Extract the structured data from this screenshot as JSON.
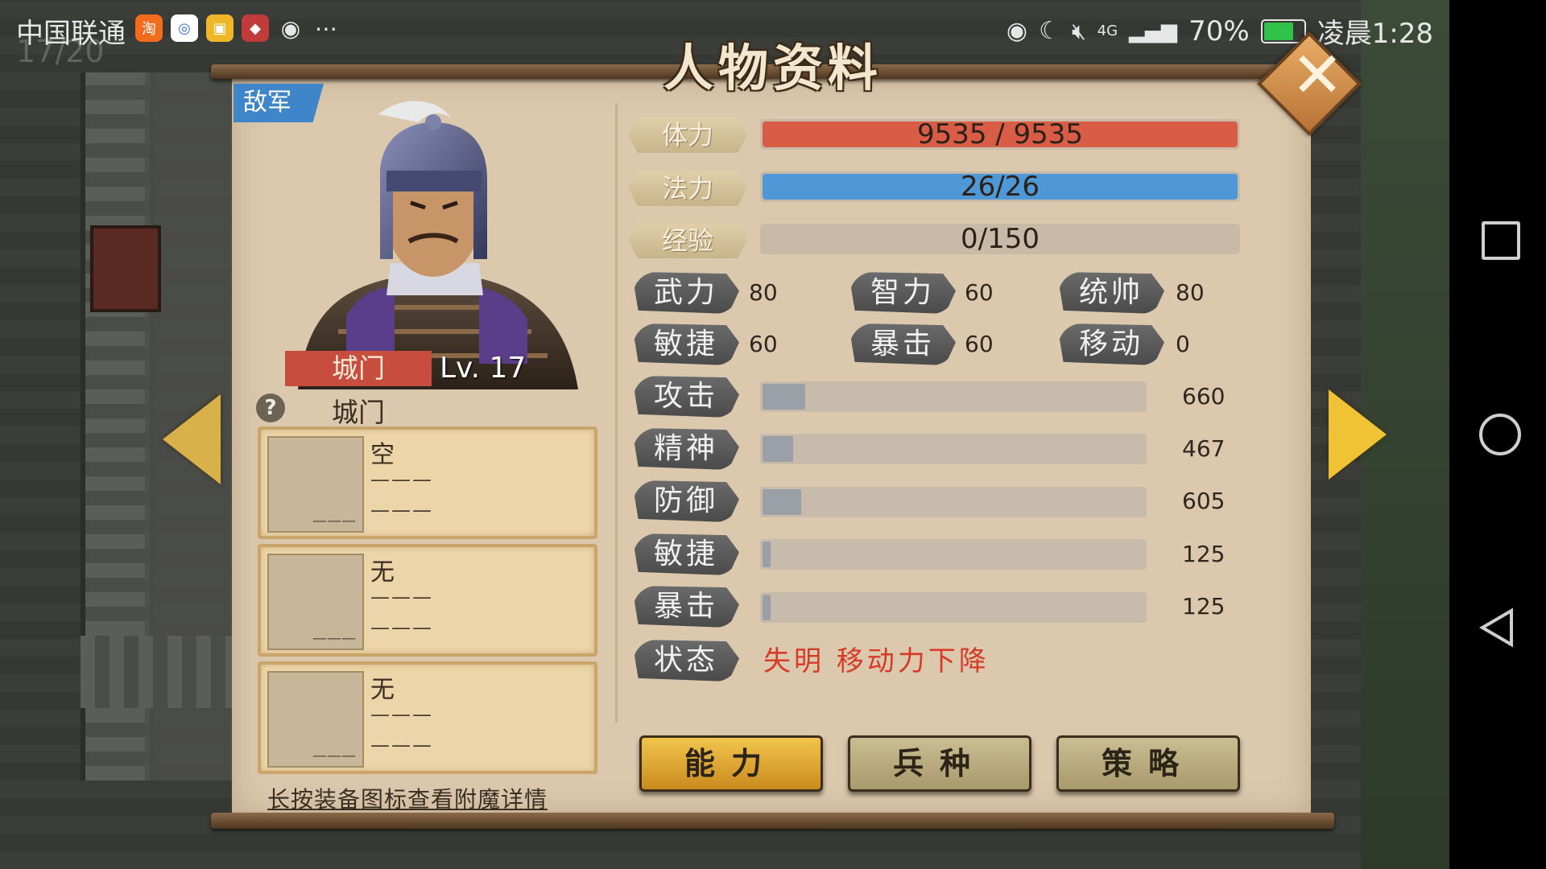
{
  "status_bar": {
    "carrier": "中国联通",
    "app_icon_1": "淘",
    "battery": "70%",
    "time": "凌晨1:28",
    "network": "4G"
  },
  "background": {
    "counter_text": "17/20"
  },
  "panel": {
    "title": "人物资料",
    "faction": "敌军",
    "unit_tag": "城门",
    "level": "Lv. 17",
    "unit_name": "城门"
  },
  "bars": {
    "hp": {
      "label": "体力",
      "text": "9535   /   9535",
      "fill": 1.0,
      "color": "#d95c46"
    },
    "mp": {
      "label": "法力",
      "text": "26/26",
      "fill": 1.0,
      "color": "#4f98d8"
    },
    "exp": {
      "label": "经验",
      "text": "0/150",
      "fill": 0.0,
      "color": "#c8baa6"
    }
  },
  "attributes": [
    {
      "label": "武力",
      "value": "80"
    },
    {
      "label": "智力",
      "value": "60"
    },
    {
      "label": "统帅",
      "value": "80"
    },
    {
      "label": "敏捷",
      "value": "60"
    },
    {
      "label": "暴击",
      "value": "60"
    },
    {
      "label": "移动",
      "value": "0"
    }
  ],
  "stats": [
    {
      "label": "攻击",
      "value": "660",
      "fill": 0.11
    },
    {
      "label": "精神",
      "value": "467",
      "fill": 0.08
    },
    {
      "label": "防御",
      "value": "605",
      "fill": 0.1
    },
    {
      "label": "敏捷",
      "value": "125",
      "fill": 0.02
    },
    {
      "label": "暴击",
      "value": "125",
      "fill": 0.02
    }
  ],
  "status": {
    "label": "状态",
    "text": "失明  移动力下降"
  },
  "equipment": [
    {
      "name": "空",
      "line1": "———",
      "line2": "———",
      "thumb": "———"
    },
    {
      "name": "无",
      "line1": "———",
      "line2": "———",
      "thumb": "———"
    },
    {
      "name": "无",
      "line1": "———",
      "line2": "———",
      "thumb": "———"
    }
  ],
  "hint": "长按装备图标查看附魔详情",
  "tabs": [
    {
      "label": "能力",
      "active": true
    },
    {
      "label": "兵种",
      "active": false
    },
    {
      "label": "策略",
      "active": false
    }
  ],
  "icons": {
    "close": "close-icon",
    "prev": "arrow-left-icon",
    "next": "arrow-right-icon",
    "help": "?"
  }
}
